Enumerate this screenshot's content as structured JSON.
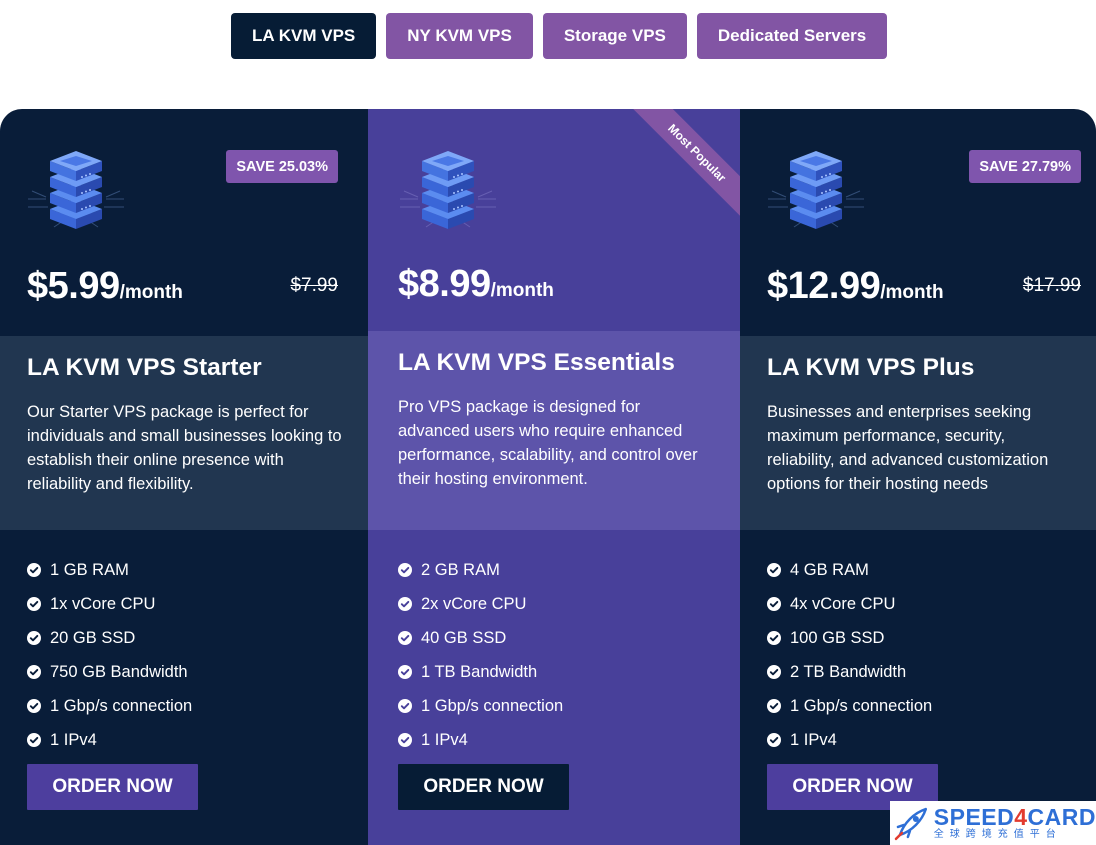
{
  "tabs": [
    {
      "label": "LA KVM VPS",
      "active": true
    },
    {
      "label": "NY KVM VPS",
      "active": false
    },
    {
      "label": "Storage VPS",
      "active": false
    },
    {
      "label": "Dedicated Servers",
      "active": false
    }
  ],
  "colors": {
    "dark_navy": "#061c35",
    "card_dark": "#091d39",
    "card_featured": "#48409a",
    "accent_purple": "#8255a4",
    "band_dark": "#213650",
    "band_featured": "#5d54aa",
    "order_button": "#4d3e9e"
  },
  "plans": [
    {
      "icon": "server-stack-icon",
      "save_badge": "SAVE 25.03%",
      "price": "$5.99",
      "period": "/month",
      "old_price": "$7.99",
      "title": "LA KVM VPS Starter",
      "description": "Our Starter VPS package is perfect for individuals and small businesses looking to establish their online presence with reliability and flexibility.",
      "features": [
        "1 GB RAM",
        "1x vCore CPU",
        "20 GB SSD",
        "750 GB Bandwidth",
        "1 Gbp/s connection",
        "1 IPv4"
      ],
      "button": "ORDER NOW"
    },
    {
      "icon": "server-stack-icon",
      "ribbon": "Most Popular",
      "price": "$8.99",
      "period": "/month",
      "title": "LA KVM VPS Essentials",
      "description": "Pro VPS package is designed for advanced users who require enhanced performance, scalability, and control over their hosting environment.",
      "features": [
        "2 GB RAM",
        "2x vCore CPU",
        "40 GB SSD",
        "1 TB Bandwidth",
        "1 Gbp/s connection",
        "1 IPv4"
      ],
      "button": "ORDER NOW"
    },
    {
      "icon": "server-stack-icon",
      "save_badge": "SAVE 27.79%",
      "price": "$12.99",
      "period": "/month",
      "old_price": "$17.99",
      "title": "LA KVM VPS Plus",
      "description": "Businesses and enterprises seeking maximum performance, security, reliability, and advanced customization options for their hosting needs",
      "features": [
        "4 GB RAM",
        "4x vCore CPU",
        "100 GB SSD",
        "2 TB Bandwidth",
        "1 Gbp/s connection",
        "1 IPv4"
      ],
      "button": "ORDER NOW"
    }
  ],
  "watermark": {
    "brand_prefix": "SPEED",
    "brand_digit": "4",
    "brand_suffix": "CARD",
    "tagline": "全球跨境充值平台",
    "icon": "rocket-icon"
  }
}
